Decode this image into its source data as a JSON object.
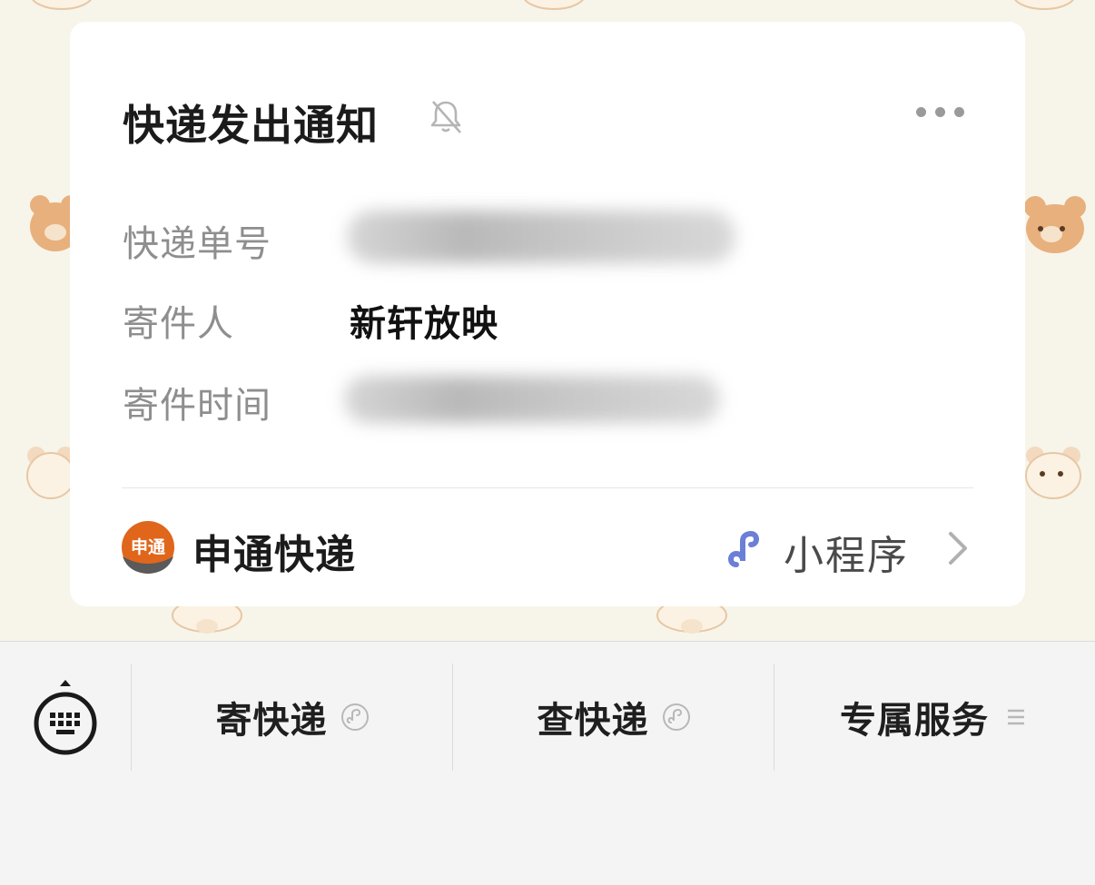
{
  "card": {
    "title": "快递发出通知",
    "rows": [
      {
        "label": "快递单号",
        "value": ""
      },
      {
        "label": "寄件人",
        "value": "新轩放映"
      },
      {
        "label": "寄件时间",
        "value": ""
      }
    ],
    "footer": {
      "brand_logo_text": "申通",
      "brand_name": "申通快递",
      "mini_program_label": "小程序"
    }
  },
  "menu": {
    "items": [
      {
        "label": "寄快递",
        "icon": "mini-program-icon"
      },
      {
        "label": "查快递",
        "icon": "mini-program-icon"
      },
      {
        "label": "专属服务",
        "icon": "list-icon"
      }
    ]
  },
  "colors": {
    "brand_orange": "#e0661c",
    "mini_program_blue": "#6b7fd7",
    "wallpaper": "#f7f5ea"
  }
}
